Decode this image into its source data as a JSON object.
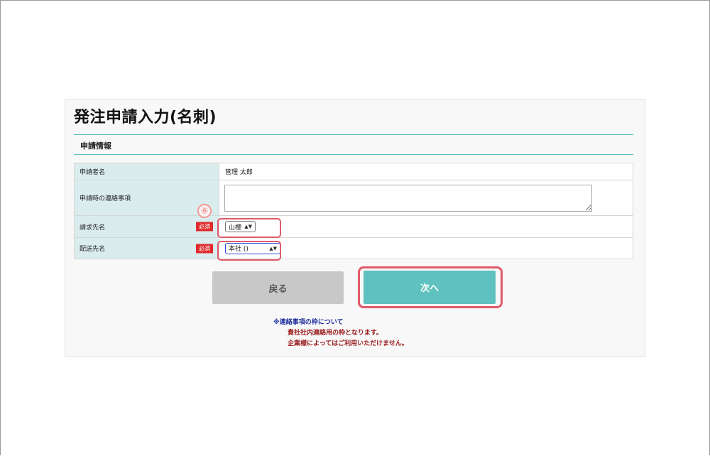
{
  "page": {
    "title": "発注申請入力(名刺)",
    "section_title": "申請情報"
  },
  "form": {
    "rows": [
      {
        "label": "申請者名",
        "value": "管理 太郎"
      },
      {
        "label": "申請時の連絡事項",
        "value": ""
      },
      {
        "label": "請求先名",
        "required": "必須",
        "select_value": "山櫻"
      },
      {
        "label": "配送先名",
        "required": "必須",
        "select_value": "本社 ()"
      }
    ]
  },
  "annotation": {
    "step_marker": "⑥",
    "highlight_color": "#e05a6b"
  },
  "buttons": {
    "back": "戻る",
    "next": "次へ"
  },
  "notes": [
    "※連絡事項の枠について",
    "貴社社内連絡用の枠となります。",
    "企業様によってはご利用いただけません。"
  ],
  "colors": {
    "accent_teal": "#5fc2c0",
    "label_bg": "#daeced",
    "required_badge": "#e02a2a",
    "note_blue": "#1c2c9c",
    "note_red": "#9a1b1b"
  }
}
